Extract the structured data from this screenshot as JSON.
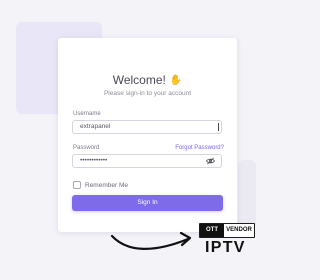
{
  "login": {
    "title": "Welcome!",
    "title_icon": "waving-hand-icon",
    "subtitle": "Please sign-in to your account",
    "username": {
      "label": "Username",
      "value": "extrapanel"
    },
    "password": {
      "label": "Password",
      "value": "••••••••••••",
      "visibility_icon": "eye-off-icon"
    },
    "forgot_password": "Forgot Password?",
    "remember_me": {
      "label": "Remember Me",
      "checked": false
    },
    "sign_in_button": "Sign In"
  },
  "branding": {
    "badge_left": "OTT",
    "badge_right": "VENDOR",
    "product": "IPTV",
    "arrow_icon": "curved-arrow-icon"
  },
  "colors": {
    "page_background": "#f4f3f8",
    "card_background": "#ffffff",
    "accent": "#7e6be9",
    "link": "#7a66f0",
    "border": "#d7d4df",
    "brand_dark": "#111111"
  }
}
